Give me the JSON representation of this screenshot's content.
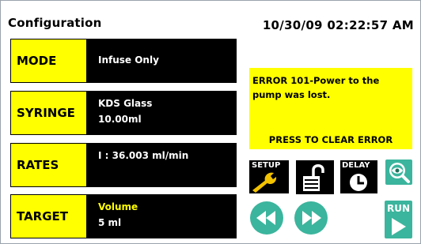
{
  "header": {
    "title": "Configuration",
    "datetime": "10/30/09 02:22:57 AM"
  },
  "rows": [
    {
      "label": "MODE",
      "line1": "Infuse Only"
    },
    {
      "label": "SYRINGE",
      "line1": "KDS Glass",
      "line2": "10.00ml"
    },
    {
      "label": "RATES",
      "line1": "I : 36.003 ml/min"
    },
    {
      "label": "TARGET",
      "line1": "Volume",
      "line2": "5 ml"
    }
  ],
  "error": {
    "message": "ERROR 101-Power to the pump was lost.",
    "clear": "PRESS TO CLEAR ERROR"
  },
  "buttons": {
    "setup": "SETUP",
    "delay": "DELAY",
    "run": "RUN"
  },
  "colors": {
    "label_yellow": "#ffff00",
    "teal": "#3bb59d",
    "panel_black": "#000000"
  },
  "icons": [
    "wrench-icon",
    "unlock-icon",
    "clock-icon",
    "eye-search-icon",
    "rewind-icon",
    "fast-forward-icon",
    "play-icon"
  ]
}
